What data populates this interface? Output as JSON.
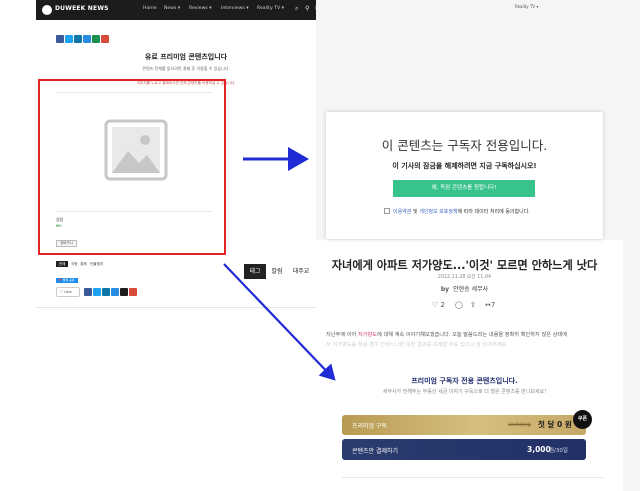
{
  "nav": {
    "brand": "DUWEEK NEWS",
    "items": [
      {
        "label": "Home"
      },
      {
        "label": "News ▾"
      },
      {
        "label": "Reviews ▾"
      },
      {
        "label": "Interviews ▾"
      },
      {
        "label": "Reality TV ▾"
      }
    ]
  },
  "left": {
    "title": "유료 프리미엄 콘텐츠입니다",
    "subtitle": "콘텐츠 전체를 읽으려면 결제 후 이용할 수 있습니다.",
    "hint": "이미지를 누르고 결제하시면 전체 콘텐츠를 이용하실 수 있습니다.",
    "product_name": "실장",
    "product_price": "₩0",
    "product_button": "장바구니",
    "tabs": [
      "전체",
      "국정",
      "경제",
      "인물정치"
    ],
    "share_badge": "📌 발행 공유",
    "like": "♡ Like"
  },
  "side_tabs": [
    "태그",
    "칼럼",
    "대주교"
  ],
  "subscription": {
    "title": "이 콘텐츠는 구독자 전용입니다.",
    "description": "이 기사의 잠금을 해제하려면 지금 구독하십시오!",
    "button": "예, 독점 콘텐츠를 원합니다!",
    "consent_link1": "이용약관",
    "consent_mid": " 및 ",
    "consent_link2": "개인정보 보호정책",
    "consent_tail": "에 따라 데이터 처리에 동의합니다."
  },
  "article": {
    "title": "자녀에게 아파트 저가양도...'이것' 모르면 안하느게 낫다",
    "date": "2022.11.28 오전 11:04",
    "by": "by",
    "author": "안현승 세무사",
    "reactions": [
      "♡ 2",
      "◯",
      "⇧",
      "↔7"
    ],
    "body_1_a": "지난주에 이어 ",
    "body_1_hl": "저가양도",
    "body_1_b": "에 대해 계속 이야기해보겠습니다. 오늘 말씀드리는 내용을 정확히 확인하지 않은 상태에",
    "body_2": "서 저가양도를 하실 경우 안하느니만 못한 결과를 초래할 수도 있으니 잘 읽어주세요."
  },
  "premium": {
    "title": "프리미엄 구독자 전용 콘텐츠입니다.",
    "subtitle": "세무사가 전해주는 부동산 세금 이야기 구독으로 더 많은 콘텐츠를 만나보세요!",
    "plan_label": "프리미엄 구독",
    "plan_strike": "10,900원/월",
    "plan_price": "첫 달 0 원",
    "single_label": "콘텐츠만 결제하기",
    "single_price": "3,000",
    "single_unit": "원/30일",
    "coupon": "쿠폰"
  },
  "colors": {
    "annotation_red": "#e02424",
    "annotation_arrow": "#1f2bd4",
    "cta_green": "#38c28c",
    "gold": "#c9ad6a",
    "navy": "#263569"
  }
}
